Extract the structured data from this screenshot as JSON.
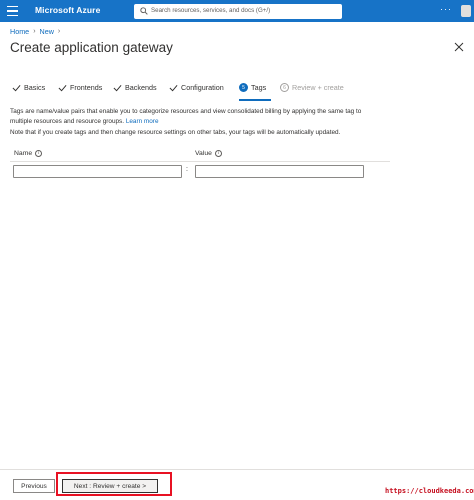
{
  "topbar": {
    "brand": "Microsoft Azure",
    "search_placeholder": "Search resources, services, and docs (G+/)",
    "more_label": "···",
    "accent_color": "#1773c7"
  },
  "breadcrumb": [
    "Home",
    "New"
  ],
  "page_title": "Create application gateway",
  "tabs": [
    {
      "label": "Basics",
      "state": "completed",
      "icon": "checkmark-icon"
    },
    {
      "label": "Frontends",
      "state": "completed",
      "icon": "checkmark-icon"
    },
    {
      "label": "Backends",
      "state": "completed",
      "icon": "checkmark-icon"
    },
    {
      "label": "Configuration",
      "state": "completed",
      "icon": "checkmark-icon"
    },
    {
      "label": "Tags",
      "state": "active",
      "number": "5"
    },
    {
      "label": "Review + create",
      "state": "disabled",
      "number": "6"
    }
  ],
  "description": {
    "text": "Tags are name/value pairs that enable you to categorize resources and view consolidated billing by applying the same tag to multiple resources and resource groups.",
    "link": "Learn more"
  },
  "note": "Note that if you create tags and then change resource settings on other tabs, your tags will be automatically updated.",
  "tag_table": {
    "name_header": "Name",
    "value_header": "Value",
    "info_glyph": "i",
    "separator": ":",
    "name_value": "",
    "value_value": ""
  },
  "footer": {
    "previous_label": "Previous",
    "next_label": "Next : Review + create >"
  },
  "watermark": "https://cloudkeeda.com"
}
